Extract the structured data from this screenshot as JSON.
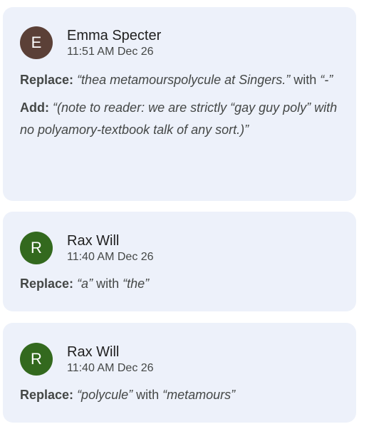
{
  "comments": [
    {
      "avatar_letter": "E",
      "avatar_color": "#5b4037",
      "author": "Emma Specter",
      "time": "11:51 AM Dec 26",
      "replace_label": "Replace:",
      "replace_from": "“thea metamourspolycule at Singers.”",
      "with_word": "with",
      "replace_to": "“-”",
      "add_label": "Add:",
      "add_text": "“(note to reader: we are strictly “gay guy poly” with no polyamory-textbook talk of any sort.)”"
    },
    {
      "avatar_letter": "R",
      "avatar_color": "#33691e",
      "author": "Rax Will",
      "time": "11:40 AM Dec 26",
      "replace_label": "Replace:",
      "replace_from": "“a”",
      "with_word": "with",
      "replace_to": "“the”"
    },
    {
      "avatar_letter": "R",
      "avatar_color": "#33691e",
      "author": "Rax Will",
      "time": "11:40 AM Dec 26",
      "replace_label": "Replace:",
      "replace_from": "“polycule”",
      "with_word": "with",
      "replace_to": "“metamours”"
    }
  ]
}
